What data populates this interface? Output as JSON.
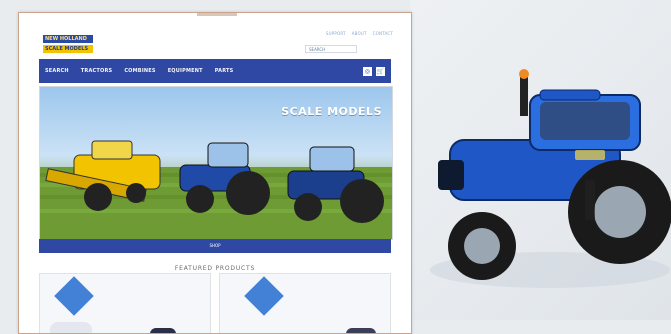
{
  "site": {
    "logo_text_top": "NEW HOLLAND",
    "logo_text_bottom": "SCALE MODELS",
    "top_links": [
      "SUPPORT",
      "ABOUT",
      "CONTACT"
    ],
    "search_placeholder": "SEARCH",
    "nav": [
      "SEARCH",
      "TRACTORS",
      "COMBINES",
      "EQUIPMENT",
      "PARTS"
    ],
    "hero_title": "SCALE MODELS",
    "hero_banner_caption": "SHOP",
    "section_title": "FEATURED PRODUCTS"
  },
  "colors": {
    "primary": "#2f48a4",
    "accent": "#f2c300",
    "badge": "#2f73d0"
  },
  "icons": {
    "cart": "cart-icon",
    "user": "user-icon"
  }
}
